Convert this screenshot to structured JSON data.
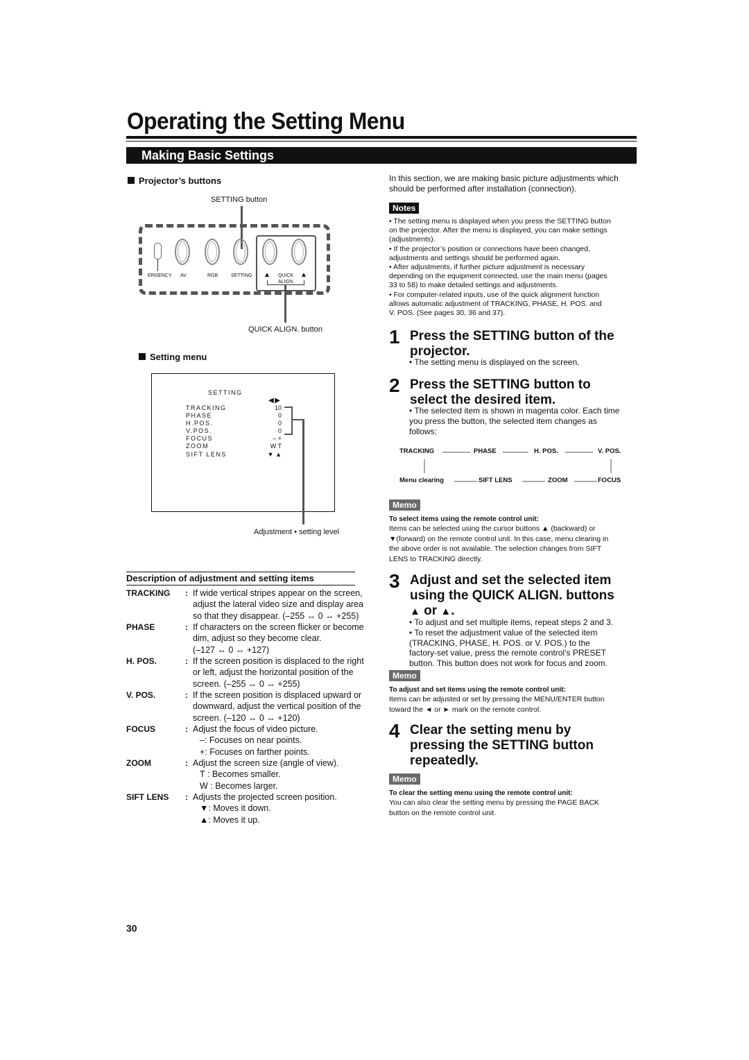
{
  "page": {
    "title": "Operating the Setting Menu",
    "section_title": "Making Basic Settings",
    "page_number": "30"
  },
  "projector_buttons": {
    "heading": "Projector’s buttons",
    "setting_button_callout": "SETTING button",
    "quick_align_callout": "QUICK ALIGN. button",
    "labels": [
      "ERGENCY",
      "AV",
      "RGB",
      "SETTING",
      "QUICK",
      "ALIGN."
    ],
    "minus_icon": "triangle-minus-icon",
    "plus_icon": "triangle-plus-icon"
  },
  "setting_menu": {
    "heading": "Setting menu",
    "screen_title": "SETTING",
    "arrows": "◀▶",
    "rows": [
      {
        "label": "TRACKING",
        "value": "10"
      },
      {
        "label": "PHASE",
        "value": "0"
      },
      {
        "label": "H.POS.",
        "value": "0"
      },
      {
        "label": "V.POS.",
        "value": "0"
      },
      {
        "label": "FOCUS",
        "value": "–    +"
      },
      {
        "label": "ZOOM",
        "value": "W   T"
      },
      {
        "label": "SIFT LENS",
        "value": "▼  ▲"
      }
    ],
    "callout": "Adjustment • setting level"
  },
  "description": {
    "heading": "Description of adjustment and setting items",
    "items": [
      {
        "term": "TRACKING",
        "lines": [
          "If wide vertical stripes appear on the screen,",
          "adjust the lateral video size and display area",
          "so that they disappear. (–255 ↔ 0 ↔ +255)"
        ]
      },
      {
        "term": "PHASE",
        "lines": [
          "If characters on the screen flicker or become",
          "dim, adjust so they become clear.",
          "(–127 ↔ 0 ↔ +127)"
        ]
      },
      {
        "term": "H. POS.",
        "lines": [
          "If the screen position is displaced to the right",
          "or left, adjust the horizontal position of the",
          "screen. (–255 ↔ 0 ↔ +255)"
        ]
      },
      {
        "term": "V. POS.",
        "lines": [
          "If the screen position is displaced upward or",
          "downward, adjust the vertical position of the",
          "screen. (–120 ↔ 0 ↔ +120)"
        ]
      },
      {
        "term": "FOCUS",
        "lines": [
          "Adjust the focus of video picture.",
          "–:   Focuses on near points.",
          "+:   Focuses on farther points."
        ]
      },
      {
        "term": "ZOOM",
        "lines": [
          "Adjust the screen size (angle of view).",
          "T  : Becomes smaller.",
          "W : Becomes larger."
        ]
      },
      {
        "term": "SIFT LENS",
        "lines": [
          "Adjusts the projected screen position.",
          "▼:  Moves it down.",
          "▲:  Moves it up."
        ]
      }
    ]
  },
  "intro": [
    "In this section, we are making basic picture adjustments which",
    "should be performed after installation (connection)."
  ],
  "notes": {
    "label": "Notes",
    "lines": [
      "• The setting menu is displayed when you press the SETTING button",
      "   on the projector. After the menu is displayed, you can make settings",
      "   (adjustments).",
      "• If the projector’s position or connections have been changed,",
      "   adjustments and settings should be performed again.",
      "• After adjustments, if further picture adjustment is necessary",
      "   depending on the equipment connected, use the main menu (pages",
      "   33 to 58) to make detailed settings and adjustments.",
      "• For computer-related inputs, use of the quick alignment function",
      "   allows automatic adjustment of TRACKING, PHASE, H. POS. and",
      "   V. POS. (See pages 30, 36 and 37)."
    ]
  },
  "steps": [
    {
      "number": "1",
      "title_lines": [
        "Press the SETTING button of the",
        "projector."
      ],
      "bullets": [
        "• The setting menu is displayed on the screen."
      ]
    },
    {
      "number": "2",
      "title_lines": [
        "Press the SETTING button to",
        "select the desired item."
      ],
      "bullets": [
        "• The selected item is shown in magenta color. Each time",
        "   you press the button, the selected item changes as",
        "   follows:"
      ]
    },
    {
      "number": "3",
      "title_lines": [
        "Adjust and set the selected item",
        "using the QUICK ALIGN. buttons",
        "or"
      ],
      "bullets": [
        "• To adjust and set multiple items, repeat steps 2 and 3.",
        "• To reset the adjustment value of the selected item",
        "   (TRACKING, PHASE, H. POS. or V. POS.) to the",
        "   factory-set value, press the remote control’s PRESET",
        "   button. This button does not work for focus and zoom."
      ]
    },
    {
      "number": "4",
      "title_lines": [
        "Clear the setting menu by",
        "pressing the SETTING button",
        "repeatedly."
      ],
      "bullets": []
    }
  ],
  "flow": {
    "top": [
      "TRACKING",
      "PHASE",
      "H. POS.",
      "V. POS."
    ],
    "bottom": [
      "Menu clearing",
      "SIFT LENS",
      "ZOOM",
      "FOCUS"
    ]
  },
  "memos": [
    {
      "label": "Memo",
      "heading": "To select items using the remote control unit:",
      "lines": [
        "Items can be selected using the cursor buttons ▲  (backward) or",
        "▼(forward) on the remote control unit. In this case, menu clearing in",
        "the above order is not available. The selection changes from SIFT",
        "LENS to TRACKING directly."
      ]
    },
    {
      "label": "Memo",
      "heading": "To adjust and set items using the remote control unit:",
      "lines": [
        "Items can be adjusted or set by pressing the MENU/ENTER button",
        "toward the ◄ or ► mark on the remote control."
      ]
    },
    {
      "label": "Memo",
      "heading": "To clear the setting menu using the remote control unit:",
      "lines": [
        "You can also clear the setting menu by pressing the PAGE BACK",
        "button on the remote control unit."
      ]
    }
  ]
}
